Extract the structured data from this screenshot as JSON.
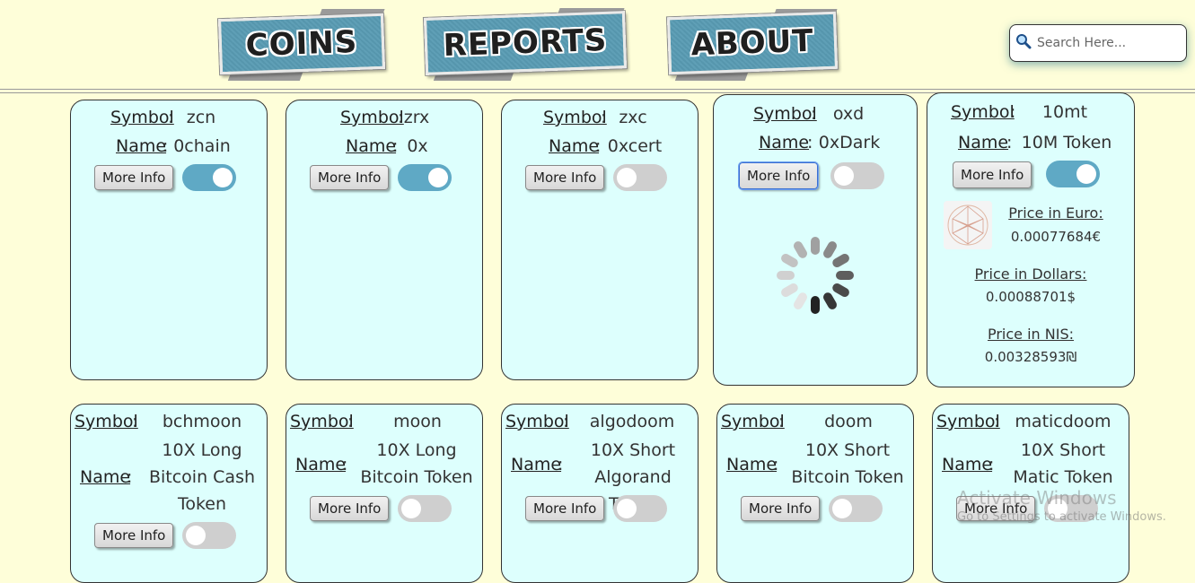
{
  "nav": {
    "coins": "COINS",
    "reports": "REPORTS",
    "about": "ABOUT"
  },
  "search": {
    "placeholder": "Search Here..."
  },
  "labels": {
    "symbol": "Symbol",
    "name": "Name",
    "colon": ":",
    "more_info": "More Info",
    "price_euro": "Price in Euro:",
    "price_dollars": "Price in Dollars:",
    "price_nis": "Price in NIS:"
  },
  "cards": [
    {
      "symbol": "zcn",
      "name": "0chain",
      "toggle_on": true
    },
    {
      "symbol": "zrx",
      "name": "0x",
      "toggle_on": true
    },
    {
      "symbol": "zxc",
      "name": "0xcert",
      "toggle_on": false
    },
    {
      "symbol": "oxd",
      "name": "0xDark",
      "toggle_on": false,
      "loading": true
    },
    {
      "symbol": "10mt",
      "name": "10M Token",
      "toggle_on": true,
      "prices": {
        "euro": "0.00077684€",
        "dollars": "0.00088701$",
        "nis": "0.00328593₪"
      }
    },
    {
      "symbol": "bchmoon",
      "name_lines": [
        "10X Long",
        "Bitcoin Cash",
        "Token"
      ],
      "toggle_on": false
    },
    {
      "symbol": "moon",
      "name_lines": [
        "10X Long",
        "Bitcoin Token"
      ],
      "toggle_on": false
    },
    {
      "symbol": "algodoom",
      "name_lines": [
        "10X Short",
        "Algorand Token"
      ],
      "toggle_on": false
    },
    {
      "symbol": "doom",
      "name_lines": [
        "10X Short",
        "Bitcoin Token"
      ],
      "toggle_on": false
    },
    {
      "symbol": "maticdoom",
      "name_lines": [
        "10X Short",
        "Matic Token"
      ],
      "toggle_on": false
    }
  ],
  "watermark": {
    "title": "Activate Windows",
    "subtitle": "Go to Settings to activate Windows."
  },
  "colors": {
    "background": "#fefed9",
    "card": "#ddfffd",
    "toggle_on": "#5fa9c5",
    "toggle_off": "#cfcfcf",
    "nav_button": "#5f9fb6"
  }
}
